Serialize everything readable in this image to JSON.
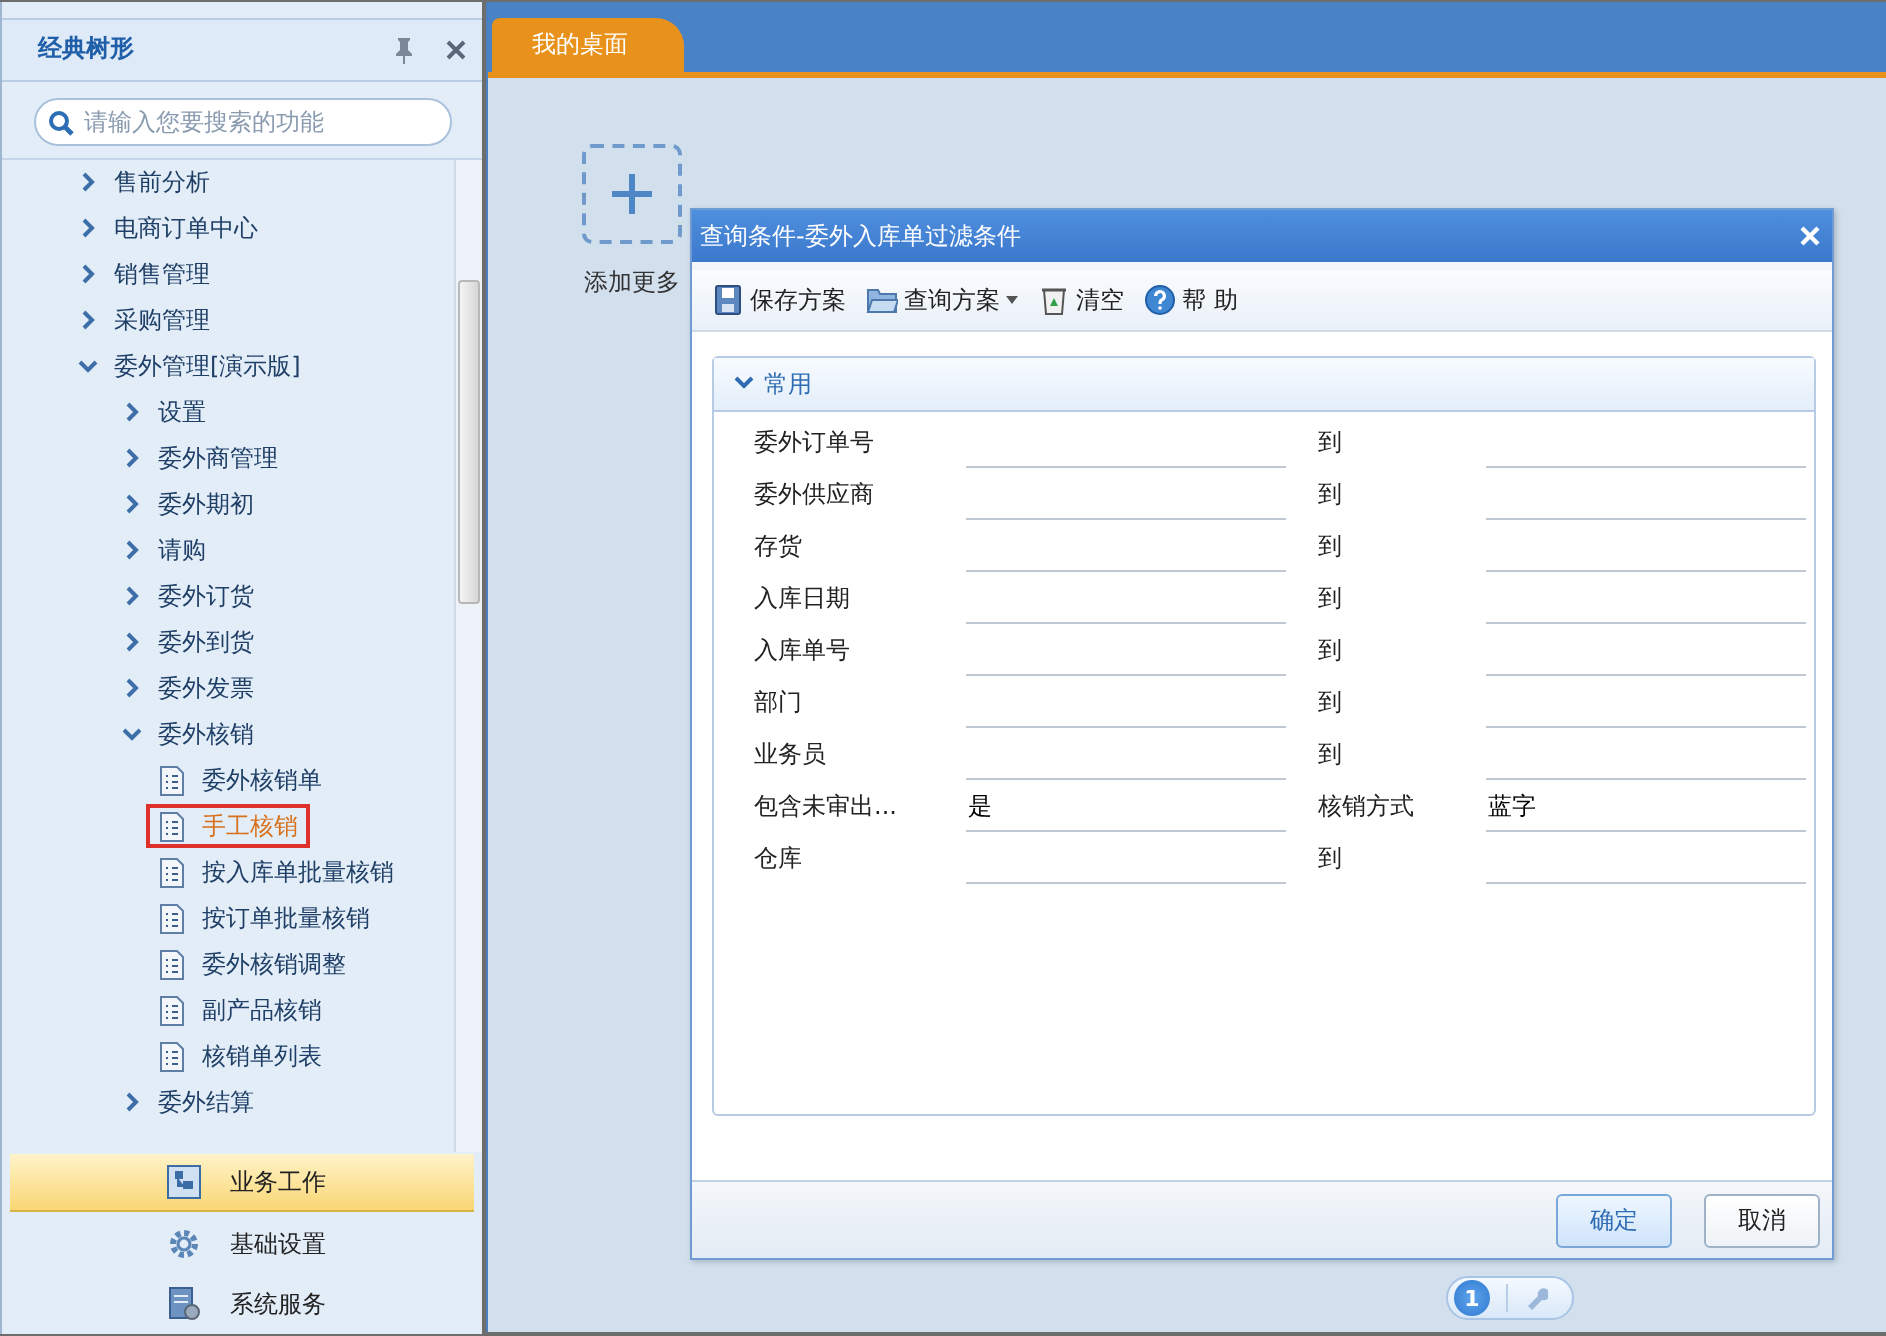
{
  "sidebar": {
    "title": "经典树形",
    "search": {
      "placeholder": "请输入您要搜索的功能"
    },
    "tree": [
      {
        "label": "售前分析",
        "kind": "folder",
        "expanded": false
      },
      {
        "label": "电商订单中心",
        "kind": "folder",
        "expanded": false
      },
      {
        "label": "销售管理",
        "kind": "folder",
        "expanded": false
      },
      {
        "label": "采购管理",
        "kind": "folder",
        "expanded": false
      },
      {
        "label": "委外管理[演示版]",
        "kind": "folder",
        "expanded": true,
        "children": [
          {
            "label": "设置",
            "kind": "folder",
            "expanded": false
          },
          {
            "label": "委外商管理",
            "kind": "folder",
            "expanded": false
          },
          {
            "label": "委外期初",
            "kind": "folder",
            "expanded": false
          },
          {
            "label": "请购",
            "kind": "folder",
            "expanded": false
          },
          {
            "label": "委外订货",
            "kind": "folder",
            "expanded": false
          },
          {
            "label": "委外到货",
            "kind": "folder",
            "expanded": false
          },
          {
            "label": "委外发票",
            "kind": "folder",
            "expanded": false
          },
          {
            "label": "委外核销",
            "kind": "folder",
            "expanded": true,
            "children": [
              {
                "label": "委外核销单",
                "kind": "leaf",
                "selected": false
              },
              {
                "label": "手工核销",
                "kind": "leaf",
                "selected": true
              },
              {
                "label": "按入库单批量核销",
                "kind": "leaf",
                "selected": false
              },
              {
                "label": "按订单批量核销",
                "kind": "leaf",
                "selected": false
              },
              {
                "label": "委外核销调整",
                "kind": "leaf",
                "selected": false
              },
              {
                "label": "副产品核销",
                "kind": "leaf",
                "selected": false
              },
              {
                "label": "核销单列表",
                "kind": "leaf",
                "selected": false
              }
            ]
          },
          {
            "label": "委外结算",
            "kind": "folder",
            "expanded": false
          }
        ]
      }
    ],
    "nav": [
      {
        "label": "业务工作",
        "kind": "tree",
        "selected": true
      },
      {
        "label": "基础设置",
        "kind": "gear",
        "selected": false
      },
      {
        "label": "系统服务",
        "kind": "server",
        "selected": false
      }
    ]
  },
  "tabs": [
    {
      "label": "我的桌面",
      "selected": true
    }
  ],
  "desktop": {
    "add_label": "添加更多"
  },
  "dialog": {
    "title": "查询条件-委外入库单过滤条件",
    "toolbar": [
      {
        "label": "保存方案",
        "kind": "save",
        "dropdown": false
      },
      {
        "label": "查询方案",
        "kind": "folder",
        "dropdown": true
      },
      {
        "label": "清空",
        "kind": "trash",
        "dropdown": false
      },
      {
        "label": "帮 助",
        "kind": "help",
        "dropdown": false
      }
    ],
    "section": {
      "title": "常用",
      "expanded": true
    },
    "rows": [
      {
        "label": "委外订单号",
        "to_label": "到"
      },
      {
        "label": "委外供应商",
        "to_label": "到"
      },
      {
        "label": "存货",
        "to_label": "到"
      },
      {
        "label": "入库日期",
        "to_label": "到"
      },
      {
        "label": "入库单号",
        "to_label": "到"
      },
      {
        "label": "部门",
        "to_label": "到"
      },
      {
        "label": "业务员",
        "to_label": "到"
      },
      {
        "label": "包含未审出...",
        "value": "是",
        "to_label": "核销方式",
        "to_value": "蓝字"
      },
      {
        "label": "仓库",
        "to_label": "到"
      }
    ],
    "buttons": [
      {
        "label": "确定",
        "kind": "primary"
      },
      {
        "label": "取消",
        "kind": "normal"
      }
    ]
  },
  "pager": {
    "page": "1"
  }
}
